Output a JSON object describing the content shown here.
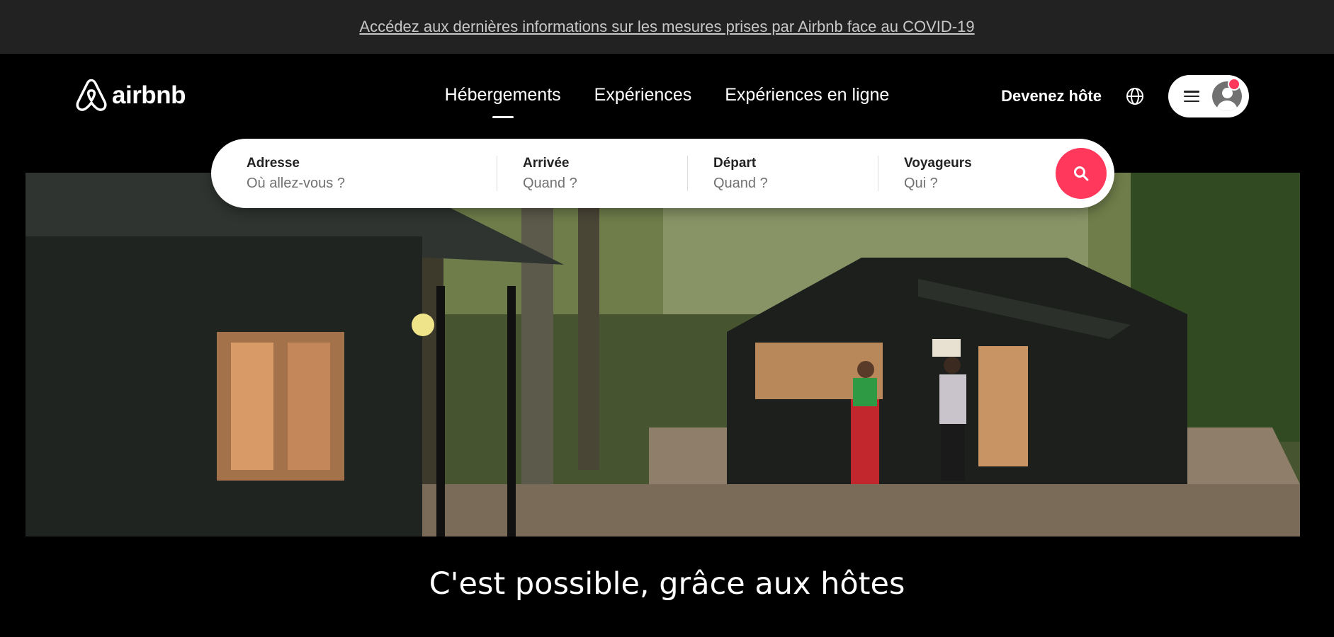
{
  "banner": {
    "text": "Accédez aux dernières informations sur les mesures prises par Airbnb face au COVID-19"
  },
  "header": {
    "logo_text": "airbnb",
    "tabs": [
      {
        "label": "Hébergements",
        "active": true
      },
      {
        "label": "Expériences",
        "active": false
      },
      {
        "label": "Expériences en ligne",
        "active": false
      }
    ],
    "become_host": "Devenez hôte"
  },
  "search": {
    "fields": [
      {
        "label": "Adresse",
        "placeholder": "Où allez-vous ?"
      },
      {
        "label": "Arrivée",
        "placeholder": "Quand ?"
      },
      {
        "label": "Départ",
        "placeholder": "Quand ?"
      },
      {
        "label": "Voyageurs",
        "placeholder": "Qui ?"
      }
    ]
  },
  "hero": {
    "tagline": "C'est possible, grâce aux hôtes"
  },
  "colors": {
    "accent": "#ff385c",
    "banner_bg": "#222222",
    "page_bg": "#000000"
  },
  "icons": [
    "airbnb-logo-icon",
    "globe-icon",
    "hamburger-icon",
    "user-avatar-icon",
    "search-icon"
  ]
}
